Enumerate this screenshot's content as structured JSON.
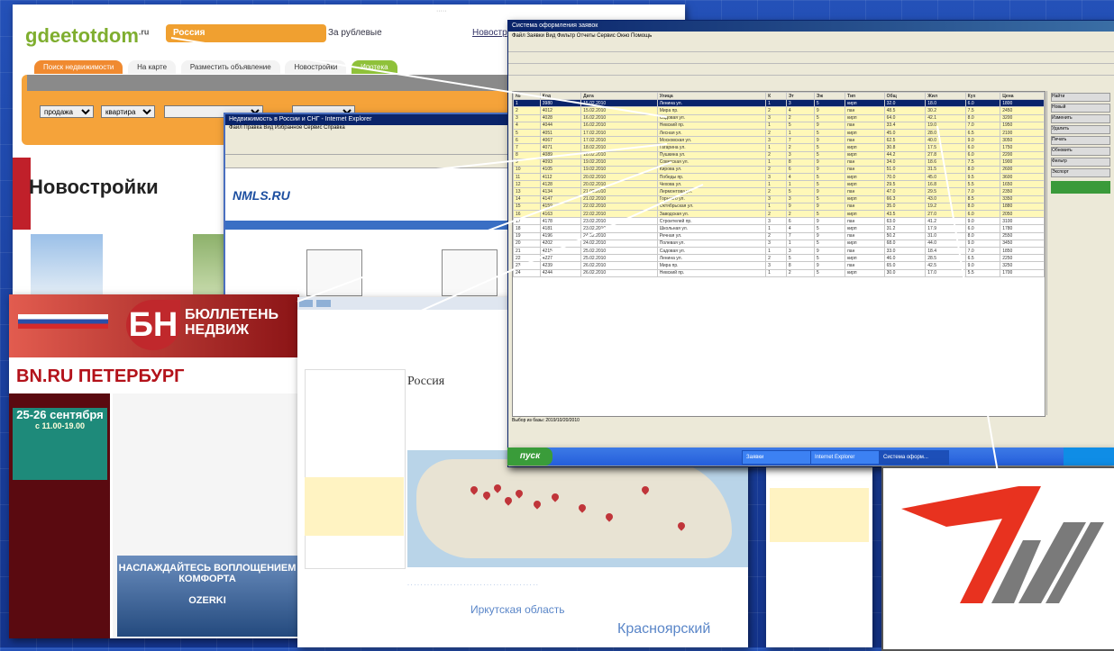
{
  "gdeetotdom": {
    "logo_text": "gdeetotdom",
    "logo_suffix": ".ru",
    "city_label": "Россия",
    "currency": "За рублевые",
    "news_link": "Новостр",
    "tabs": [
      "Поиск недвижимости",
      "На карте",
      "Разместить объявление",
      "Новостройки",
      "Ипотека"
    ],
    "search_selects": [
      "продажа",
      "квартира"
    ],
    "heading": "Новостройки"
  },
  "nmls": {
    "window_title": "Недвижимость в России и СНГ - Internet Explorer",
    "logo": "NMLS.RU"
  },
  "bn": {
    "logo_letters": "БН",
    "title_line1": "БЮЛЛЕТЕНЬ",
    "title_line2": "НЕДВИЖ",
    "site_name": "BN.RU ПЕТЕРБУРГ",
    "date_headline": "25-26 сентября",
    "date_time": "с 11.00-19.00",
    "cover_text": "НАСЛАЖДАЙТЕСЬ ВОПЛОЩЕНИЕМ КОМФОРТА",
    "cover_brand": "OZERKI"
  },
  "map_site": {
    "heading": "Россия",
    "region_big": "Красноярский",
    "region_mid": "Иркутская область"
  },
  "program": {
    "window_title": "Система оформления заявок",
    "menu": "Файл  Заявки  Вид  Фильтр  Отчеты  Сервис  Окно  Помощь",
    "status_text": "Выбор из базы: 2019/10/20/2010",
    "columns": [
      "№",
      "Код",
      "Дата",
      "Улица",
      "К",
      "Эт",
      "Эж",
      "Тип",
      "Общ",
      "Жил",
      "Кух",
      "Цена"
    ],
    "rows": [
      [
        "1",
        "3980",
        "15.02.2010",
        "Ленина ул.",
        "1",
        "3",
        "5",
        "кирп",
        "32.0",
        "18.0",
        "6.0",
        "1800"
      ],
      [
        "2",
        "4012",
        "15.02.2010",
        "Мира пр.",
        "2",
        "4",
        "9",
        "пан",
        "48.5",
        "30.2",
        "7.5",
        "2450"
      ],
      [
        "3",
        "4028",
        "16.02.2010",
        "Садовая ул.",
        "3",
        "2",
        "5",
        "кирп",
        "64.0",
        "42.1",
        "8.0",
        "3200"
      ],
      [
        "4",
        "4044",
        "16.02.2010",
        "Невский пр.",
        "1",
        "5",
        "9",
        "пан",
        "33.4",
        "19.0",
        "7.0",
        "1950"
      ],
      [
        "5",
        "4051",
        "17.02.2010",
        "Лесная ул.",
        "2",
        "1",
        "5",
        "кирп",
        "45.0",
        "28.0",
        "6.5",
        "2100"
      ],
      [
        "6",
        "4067",
        "17.02.2010",
        "Московская ул.",
        "3",
        "7",
        "9",
        "пан",
        "62.5",
        "40.0",
        "9.0",
        "3050"
      ],
      [
        "7",
        "4071",
        "18.02.2010",
        "Гагарина ул.",
        "1",
        "2",
        "5",
        "кирп",
        "30.8",
        "17.5",
        "6.0",
        "1750"
      ],
      [
        "8",
        "4089",
        "18.02.2010",
        "Пушкина ул.",
        "2",
        "3",
        "5",
        "кирп",
        "44.2",
        "27.8",
        "6.0",
        "2200"
      ],
      [
        "9",
        "4093",
        "19.02.2010",
        "Советская ул.",
        "1",
        "8",
        "9",
        "пан",
        "34.0",
        "18.6",
        "7.5",
        "1900"
      ],
      [
        "10",
        "4105",
        "19.02.2010",
        "Кирова ул.",
        "2",
        "6",
        "9",
        "пан",
        "51.0",
        "31.5",
        "8.0",
        "2600"
      ],
      [
        "11",
        "4112",
        "20.02.2010",
        "Победы пр.",
        "3",
        "4",
        "5",
        "кирп",
        "70.0",
        "45.0",
        "9.5",
        "3600"
      ],
      [
        "12",
        "4128",
        "20.02.2010",
        "Чехова ул.",
        "1",
        "1",
        "5",
        "кирп",
        "29.5",
        "16.8",
        "5.5",
        "1650"
      ],
      [
        "13",
        "4134",
        "21.02.2010",
        "Лермонтова ул.",
        "2",
        "5",
        "9",
        "пан",
        "47.0",
        "29.5",
        "7.0",
        "2350"
      ],
      [
        "14",
        "4147",
        "21.02.2010",
        "Горького ул.",
        "3",
        "3",
        "5",
        "кирп",
        "66.3",
        "43.0",
        "8.5",
        "3350"
      ],
      [
        "15",
        "4159",
        "22.02.2010",
        "Октябрьская ул.",
        "1",
        "9",
        "9",
        "пан",
        "35.0",
        "19.2",
        "8.0",
        "1880"
      ],
      [
        "16",
        "4163",
        "22.02.2010",
        "Заводская ул.",
        "2",
        "2",
        "5",
        "кирп",
        "43.5",
        "27.0",
        "6.0",
        "2050"
      ],
      [
        "17",
        "4178",
        "23.02.2010",
        "Строителей пр.",
        "3",
        "6",
        "9",
        "пан",
        "63.0",
        "41.2",
        "9.0",
        "3100"
      ],
      [
        "18",
        "4181",
        "23.02.2010",
        "Школьная ул.",
        "1",
        "4",
        "5",
        "кирп",
        "31.2",
        "17.9",
        "6.0",
        "1780"
      ],
      [
        "19",
        "4196",
        "24.02.2010",
        "Речная ул.",
        "2",
        "7",
        "9",
        "пан",
        "50.2",
        "31.0",
        "8.0",
        "2550"
      ],
      [
        "20",
        "4202",
        "24.02.2010",
        "Полевая ул.",
        "3",
        "1",
        "5",
        "кирп",
        "68.0",
        "44.0",
        "9.0",
        "3450"
      ],
      [
        "21",
        "4215",
        "25.02.2010",
        "Садовая ул.",
        "1",
        "3",
        "9",
        "пан",
        "33.0",
        "18.4",
        "7.0",
        "1850"
      ],
      [
        "22",
        "4227",
        "25.02.2010",
        "Ленина ул.",
        "2",
        "5",
        "5",
        "кирп",
        "46.0",
        "28.5",
        "6.5",
        "2250"
      ],
      [
        "23",
        "4239",
        "26.02.2010",
        "Мира пр.",
        "3",
        "8",
        "9",
        "пан",
        "65.0",
        "42.5",
        "9.0",
        "3250"
      ],
      [
        "24",
        "4244",
        "26.02.2010",
        "Невский пр.",
        "1",
        "2",
        "5",
        "кирп",
        "30.0",
        "17.0",
        "5.5",
        "1700"
      ]
    ],
    "right_panel_buttons": [
      "Найти",
      "Новый",
      "Изменить",
      "Удалить",
      "Печать",
      "Обновить",
      "Фильтр",
      "Экспорт"
    ]
  },
  "taskbar": {
    "start_label": "пуск",
    "tasks": [
      "Заявки",
      "Internet Explorer",
      "Система оформ..."
    ]
  },
  "colors": {
    "desktop_blue": "#1a3fa0",
    "logo_red": "#e8321f",
    "logo_grey": "#7a7a7a",
    "highlight_yellow": "#fff8b8"
  }
}
